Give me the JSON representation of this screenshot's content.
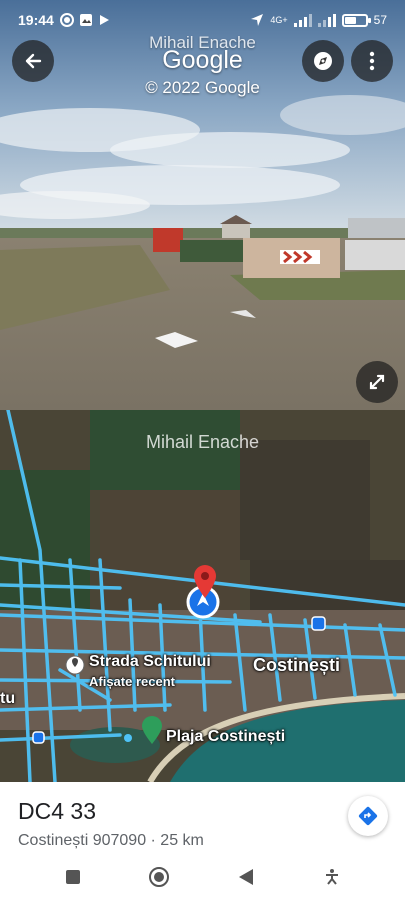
{
  "status": {
    "time": "19:44",
    "network": "4G+",
    "battery": "57",
    "battery_level": 0.57,
    "icons": [
      "notification-dot-icon",
      "gallery-icon",
      "play-icon",
      "location-arrow-icon",
      "signal-icon",
      "wifi-signal-icon",
      "battery-icon"
    ]
  },
  "streetview": {
    "author": "Mihail Enache",
    "brand": "Google",
    "copyright": "© 2022 Google",
    "buttons": [
      "back-arrow-icon",
      "compass-icon",
      "more-vert-icon",
      "expand-icon"
    ]
  },
  "map": {
    "author": "Mihail Enache",
    "labels": {
      "street": "Strada Schitului",
      "recent": "Afișate recent",
      "city": "Costinești",
      "beach": "Plaja Costinești",
      "edge": "tu"
    },
    "colors": {
      "coverage": "#4fc3f7",
      "pin": "#e53935",
      "marker": "#1a73e8",
      "beach_pin": "#2e9e5b"
    }
  },
  "place": {
    "title": "DC4 33",
    "subtitle": "Costinești 907090 · 25 km",
    "directions_icon": "directions-icon"
  },
  "navbar": {
    "icons": [
      "recents-square-icon",
      "home-circle-icon",
      "back-triangle-icon",
      "accessibility-icon"
    ]
  }
}
